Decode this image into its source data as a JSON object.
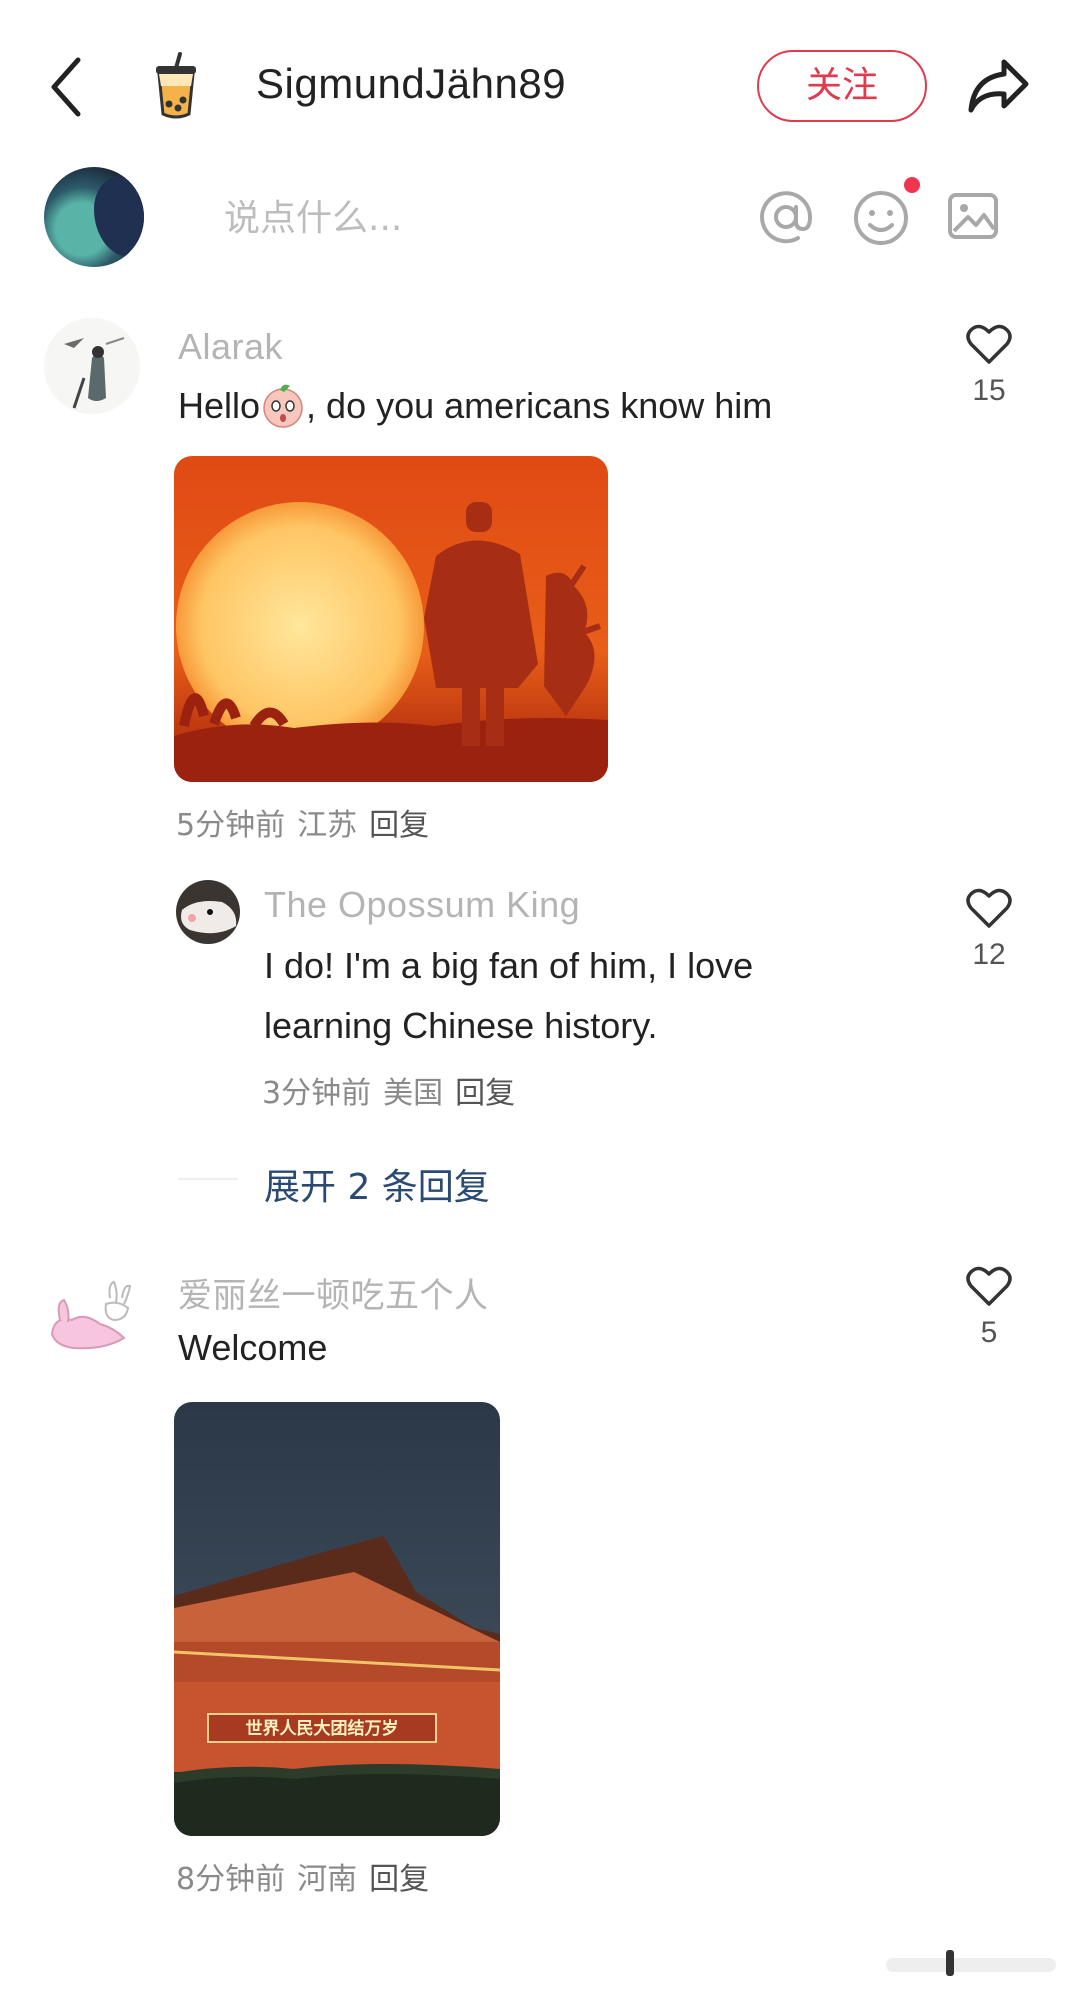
{
  "header": {
    "back_icon": "chevron-left-icon",
    "author_icon": "bubble-tea-icon",
    "author_name": "SigmundJähn89",
    "follow_label": "关注",
    "share_icon": "share-arrow-icon"
  },
  "composer": {
    "placeholder": "说点什么...",
    "mention_icon": "at-icon",
    "emoji_icon": "emoji-icon",
    "image_icon": "image-icon"
  },
  "comments": [
    {
      "username": "Alarak",
      "text_before": "Hello",
      "text_after": ", do you americans know him",
      "likes": "15",
      "time": "5分钟前",
      "location": "江苏",
      "reply_label": "回复",
      "replies": [
        {
          "username": "The Opossum King",
          "text_line1": "I do! I'm a big fan of him, I love",
          "text_line2": "learning Chinese history.",
          "likes": "12",
          "time": "3分钟前",
          "location": "美国",
          "reply_label": "回复"
        }
      ],
      "expand_label": "展开 2 条回复"
    },
    {
      "username": "爱丽丝一顿吃五个人",
      "text": "Welcome",
      "likes": "5",
      "time": "8分钟前",
      "location": "河南",
      "reply_label": "回复",
      "image_sign_text": "世界人民大团结万岁"
    }
  ],
  "colors": {
    "accent": "#e03a4e",
    "expand_link": "#2a4a74",
    "username_gray": "#b4b4b4"
  }
}
